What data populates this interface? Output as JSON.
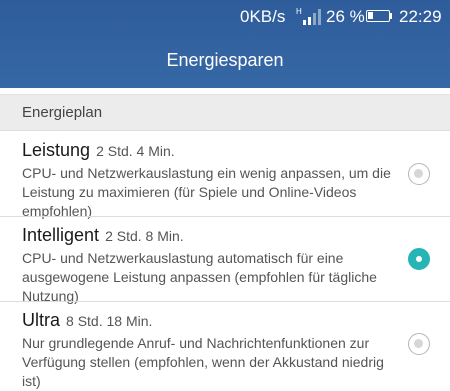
{
  "status_bar": {
    "network_speed": "0KB/s",
    "signal_label": "H",
    "battery_percent": "26 %",
    "battery_level": 0.26,
    "time": "22:29"
  },
  "header": {
    "title": "Energiesparen"
  },
  "section": {
    "label": "Energieplan"
  },
  "options": [
    {
      "title": "Leistung",
      "time": "2 Std. 4 Min.",
      "description": "CPU- und Netzwerkauslastung ein wenig anpassen, um die Leistung zu maximieren (für Spiele und Online-Videos empfohlen)",
      "selected": false
    },
    {
      "title": "Intelligent",
      "time": "2 Std. 8 Min.",
      "description": "CPU- und Netzwerkauslastung automatisch für eine ausgewogene Leistung anpassen (empfohlen für tägliche Nutzung)",
      "selected": true
    },
    {
      "title": "Ultra",
      "time": "8 Std. 18 Min.",
      "description": "Nur grundlegende Anruf- und Nachrichtenfunktionen zur Verfügung stellen (empfohlen, wenn der Akkustand niedrig ist)",
      "selected": false
    }
  ],
  "colors": {
    "header": "#3366a5",
    "accent": "#27b4b4"
  }
}
